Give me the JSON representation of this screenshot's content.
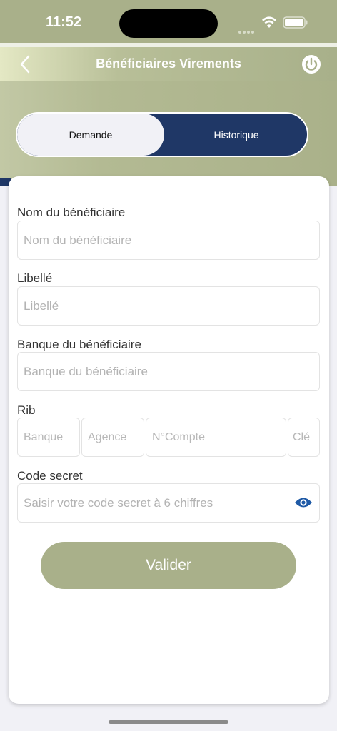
{
  "status_bar": {
    "time": "11:52"
  },
  "header": {
    "title": "Bénéficiaires Virements"
  },
  "tabs": [
    {
      "label": "Demande",
      "active": true
    },
    {
      "label": "Historique",
      "active": false
    }
  ],
  "form": {
    "beneficiary_name": {
      "label": "Nom du bénéficiaire",
      "placeholder": "Nom du bénéficiaire",
      "value": ""
    },
    "libelle": {
      "label": "Libellé",
      "placeholder": "Libellé",
      "value": ""
    },
    "bank": {
      "label": "Banque du bénéficiaire",
      "placeholder": "Banque du bénéficiaire",
      "value": ""
    },
    "rib": {
      "label": "Rib",
      "banque_placeholder": "Banque",
      "agence_placeholder": "Agence",
      "compte_placeholder": "N°Compte",
      "cle_placeholder": "Clé"
    },
    "secret_code": {
      "label": "Code secret",
      "placeholder": "Saisir votre code secret à 6 chiffres",
      "value": ""
    },
    "submit_label": "Valider"
  },
  "colors": {
    "brand_olive": "#a9b08a",
    "brand_navy": "#1f3766",
    "eye_icon": "#1f5aa6"
  },
  "icons": {
    "back": "chevron-left-icon",
    "power": "power-icon",
    "visibility": "eye-icon",
    "wifi": "wifi-icon",
    "battery": "battery-icon"
  }
}
